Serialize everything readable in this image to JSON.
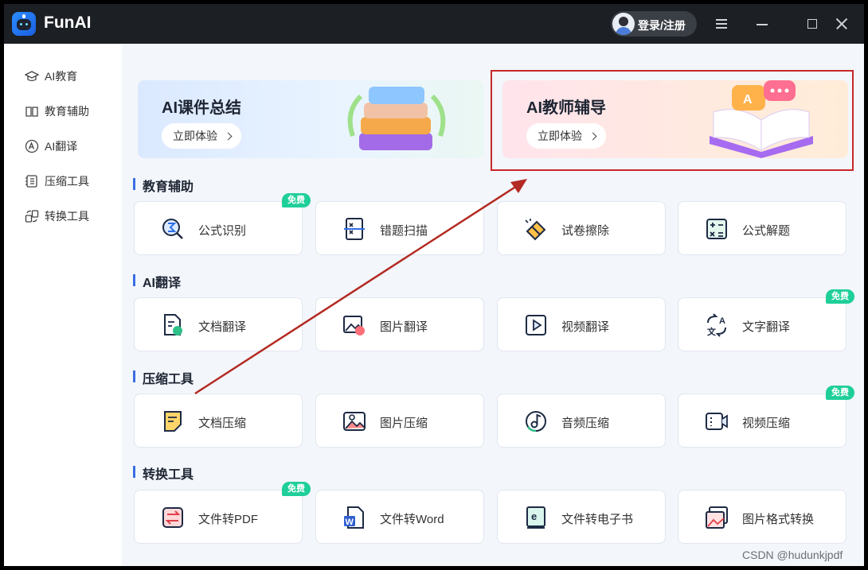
{
  "app": {
    "title": "FunAI",
    "login_label": "登录/注册"
  },
  "sidebar": {
    "items": [
      {
        "label": "AI教育",
        "icon": "graduation-cap-icon"
      },
      {
        "label": "教育辅助",
        "icon": "open-book-icon"
      },
      {
        "label": "AI翻译",
        "icon": "translate-a-icon"
      },
      {
        "label": "压缩工具",
        "icon": "compress-file-icon"
      },
      {
        "label": "转换工具",
        "icon": "convert-icon"
      }
    ]
  },
  "banners": [
    {
      "title": "AI课件总结",
      "button": "立即体验"
    },
    {
      "title": "AI教师辅导",
      "button": "立即体验"
    }
  ],
  "badge_label": "免费",
  "sections": [
    {
      "title": "教育辅助",
      "cards": [
        "公式识别",
        "错题扫描",
        "试卷擦除",
        "公式解题"
      ]
    },
    {
      "title": "AI翻译",
      "cards": [
        "文档翻译",
        "图片翻译",
        "视频翻译",
        "文字翻译"
      ]
    },
    {
      "title": "压缩工具",
      "cards": [
        "文档压缩",
        "图片压缩",
        "音频压缩",
        "视频压缩"
      ]
    },
    {
      "title": "转换工具",
      "cards": [
        "文件转PDF",
        "文件转Word",
        "文件转电子书",
        "图片格式转换"
      ]
    }
  ],
  "watermark": "CSDN @hudunkjpdf",
  "colors": {
    "accent": "#3b6fe0",
    "badge": "#1fcf9a",
    "annotation": "#c8282a"
  }
}
